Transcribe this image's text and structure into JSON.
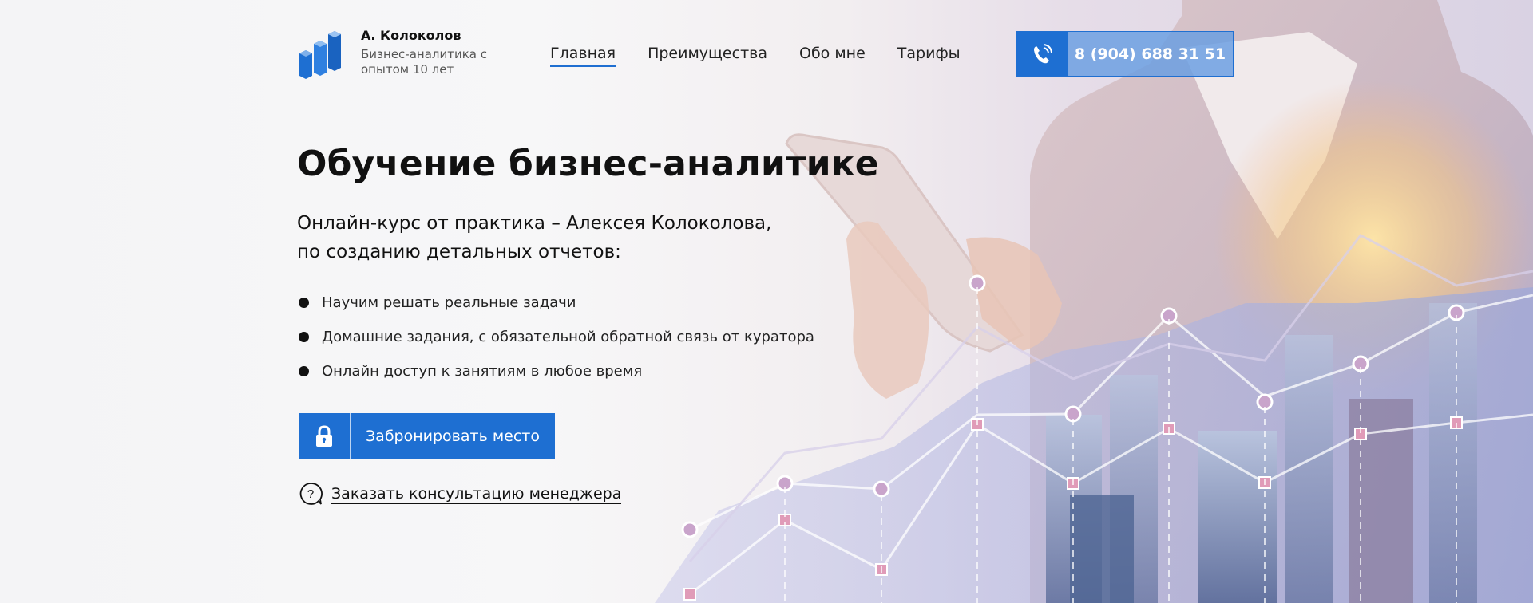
{
  "brand": {
    "name": "А. Колоколов",
    "tagline": "Бизнес-аналитика с опытом 10 лет",
    "logo_icon": "bar-chart-logo-icon"
  },
  "nav": {
    "items": [
      {
        "label": "Главная",
        "active": true
      },
      {
        "label": "Преимущества",
        "active": false
      },
      {
        "label": "Обо мне",
        "active": false
      },
      {
        "label": "Тарифы",
        "active": false
      }
    ]
  },
  "phone": {
    "icon": "phone-icon",
    "number": "8 (904) 688 31 51"
  },
  "hero": {
    "title": "Обучение бизнес-аналитике",
    "subtitle_line1": "Онлайн-курс от практика – Алексея Колоколова,",
    "subtitle_line2": "по созданию детальных отчетов:",
    "bullets": [
      "Научим решать реальные задачи",
      "Домашние задания, с обязательной обратной связь от куратора",
      "Онлайн доступ к занятиям в любое время"
    ],
    "cta_icon": "lock-icon",
    "cta_label": "Забронировать место",
    "consult_icon": "question-bubble-icon",
    "consult_label": "Заказать консультацию менеджера"
  },
  "colors": {
    "accent": "#1e6fd2",
    "phone_field": "#689de2",
    "text": "#111111"
  }
}
